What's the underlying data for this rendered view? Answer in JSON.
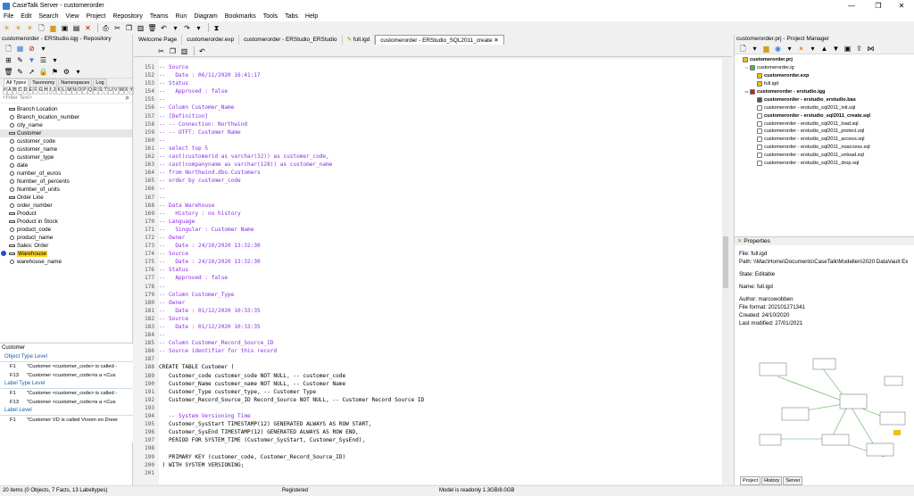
{
  "window": {
    "title": "CaseTalk Server - customerorder",
    "minimize": "—",
    "maximize": "❐",
    "close": "✕"
  },
  "menu": [
    "File",
    "Edit",
    "Search",
    "View",
    "Project",
    "Repository",
    "Teams",
    "Run",
    "Diagram",
    "Bookmarks",
    "Tools",
    "Tabs",
    "Help"
  ],
  "left_panel": {
    "header": "customerorder - ERStudio.iqg - Repository",
    "tabs": [
      "All Types",
      "Taxonomy",
      "Namespaces",
      "Log"
    ],
    "alphabet": [
      "#",
      "A",
      "B",
      "C",
      "D",
      "E",
      "F",
      "G",
      "H",
      "I",
      "J",
      "K",
      "L",
      "M",
      "N",
      "O",
      "P",
      "Q",
      "R",
      "S",
      "T",
      "U",
      "V",
      "W",
      "X",
      "Y",
      "Z"
    ],
    "filter_placeholder": "<Filter Text>",
    "tree": [
      {
        "label": "Branch Location",
        "icon": "entity-icon"
      },
      {
        "label": "Branch_location_number",
        "icon": "circle-icon"
      },
      {
        "label": "city_name",
        "icon": "circle-icon"
      },
      {
        "label": "Customer",
        "icon": "entity-icon",
        "selected": true
      },
      {
        "label": "customer_code",
        "icon": "circle-icon"
      },
      {
        "label": "customer_name",
        "icon": "circle-icon"
      },
      {
        "label": "customer_type",
        "icon": "circle-icon"
      },
      {
        "label": "date",
        "icon": "circle-icon"
      },
      {
        "label": "number_of_euros",
        "icon": "circle-icon"
      },
      {
        "label": "Number_of_percents",
        "icon": "circle-icon"
      },
      {
        "label": "Number_of_units",
        "icon": "circle-icon"
      },
      {
        "label": "Order Line",
        "icon": "entity-icon"
      },
      {
        "label": "order_number",
        "icon": "circle-icon"
      },
      {
        "label": "Product",
        "icon": "entity-icon"
      },
      {
        "label": "Product in Stock",
        "icon": "entity-icon"
      },
      {
        "label": "product_code",
        "icon": "circle-icon"
      },
      {
        "label": "product_name",
        "icon": "circle-icon"
      },
      {
        "label": "Sales: Order",
        "icon": "entity-icon"
      },
      {
        "label": "Warehouse",
        "icon": "entity-icon",
        "highlight": true
      },
      {
        "label": "warehouse_name",
        "icon": "circle-icon"
      }
    ],
    "detail": {
      "header": "Customer",
      "object_type_level": "Object Type Level",
      "otl_rows": [
        {
          "key": "F1",
          "text": "\"Customer <customer_code> is called -"
        },
        {
          "key": "F13",
          "text": "\"Customer <customer_code>is a <Cus"
        }
      ],
      "label_type_level": "Label Type Level",
      "ltl_rows": [
        {
          "key": "F1",
          "text": "\"Customer <customer_code> is called -"
        },
        {
          "key": "F13",
          "text": "\"Customer <customer_code>is a <Cus"
        }
      ],
      "label_level": "Label Level",
      "ll_rows": [
        {
          "key": "F1",
          "text": "\"Customer VD is called Vroom en Dreer"
        }
      ]
    }
  },
  "editor_tabs": [
    "Welcome Page",
    "customerorder.exp",
    "customerorder - ERStudio_ERStudio",
    "full.igd",
    "customerorder - ERStudio_SQL2011_create"
  ],
  "active_tab_index": 4,
  "code_lines": [
    {
      "n": "151",
      "t": "-- Source",
      "c": "cm"
    },
    {
      "n": "152",
      "t": "--   Date : 06/11/2020 16:41:17",
      "c": "cm"
    },
    {
      "n": "153",
      "t": "-- Status",
      "c": "cm"
    },
    {
      "n": "154",
      "t": "--   Approved : false",
      "c": "cm"
    },
    {
      "n": "155",
      "t": "--",
      "c": "cm"
    },
    {
      "n": "156",
      "t": "-- Column Customer_Name",
      "c": "cm"
    },
    {
      "n": "157",
      "t": "-- [Definition]",
      "c": "cm"
    },
    {
      "n": "158",
      "t": "-- -- Connection: Northwind",
      "c": "cm"
    },
    {
      "n": "159",
      "t": "-- -- OTFT: Customer Name",
      "c": "cm"
    },
    {
      "n": "160",
      "t": "--",
      "c": "cm"
    },
    {
      "n": "161",
      "t": "-- select top 5",
      "c": "cm"
    },
    {
      "n": "162",
      "t": "-- cast(customerid as varchar(32)) as customer_code,",
      "c": "cm"
    },
    {
      "n": "163",
      "t": "-- cast(companyname as varchar(128)) as customer_name",
      "c": "cm"
    },
    {
      "n": "164",
      "t": "-- from Northwind.dbo.Customers",
      "c": "cm"
    },
    {
      "n": "165",
      "t": "-- order by customer_code",
      "c": "cm"
    },
    {
      "n": "166",
      "t": "--",
      "c": "cm"
    },
    {
      "n": "167",
      "t": "--",
      "c": "cm"
    },
    {
      "n": "168",
      "t": "-- Data Warehouse",
      "c": "cm"
    },
    {
      "n": "169",
      "t": "--   History : no history",
      "c": "cm"
    },
    {
      "n": "170",
      "t": "-- Language",
      "c": "cm"
    },
    {
      "n": "171",
      "t": "--   Singular : Customer Name",
      "c": "cm"
    },
    {
      "n": "172",
      "t": "-- Owner",
      "c": "cm"
    },
    {
      "n": "173",
      "t": "--   Date : 24/10/2020 13:32:30",
      "c": "cm"
    },
    {
      "n": "174",
      "t": "-- Source",
      "c": "cm"
    },
    {
      "n": "175",
      "t": "--   Date : 24/10/2020 13:32:30",
      "c": "cm"
    },
    {
      "n": "176",
      "t": "-- Status",
      "c": "cm"
    },
    {
      "n": "177",
      "t": "--   Approved : false",
      "c": "cm"
    },
    {
      "n": "178",
      "t": "--",
      "c": "cm"
    },
    {
      "n": "179",
      "t": "-- Column Customer_Type",
      "c": "cm"
    },
    {
      "n": "180",
      "t": "-- Owner",
      "c": "cm"
    },
    {
      "n": "181",
      "t": "--   Date : 01/12/2020 10:33:35",
      "c": "cm"
    },
    {
      "n": "182",
      "t": "-- Source",
      "c": "cm"
    },
    {
      "n": "183",
      "t": "--   Date : 01/12/2020 10:33:35",
      "c": "cm"
    },
    {
      "n": "184",
      "t": "--",
      "c": "cm"
    },
    {
      "n": "185",
      "t": "-- Column Customer_Record_Source_ID",
      "c": "cm"
    },
    {
      "n": "186",
      "t": "-- Source identifier for this record",
      "c": "cm"
    },
    {
      "n": "187",
      "t": "",
      "c": ""
    },
    {
      "n": "188",
      "t": "CREATE TABLE Customer (",
      "c": "kw"
    },
    {
      "n": "189",
      "t": "   Customer_code customer_code NOT NULL, -- customer_code",
      "c": "mix"
    },
    {
      "n": "190",
      "t": "   Customer_Name customer_name NOT NULL, -- Customer Name",
      "c": "mix"
    },
    {
      "n": "191",
      "t": "   Customer_Type customer_type, -- Customer Type",
      "c": "mix"
    },
    {
      "n": "192",
      "t": "   Customer_Record_Source_ID Record_Source NOT NULL, -- Customer Record Source ID",
      "c": "mix"
    },
    {
      "n": "193",
      "t": "",
      "c": ""
    },
    {
      "n": "194",
      "t": "   -- System Versioning Time",
      "c": "cm"
    },
    {
      "n": "195",
      "t": "   Customer_SysStart TIMESTAMP(12) GENERATED ALWAYS AS ROW START,",
      "c": "mix"
    },
    {
      "n": "196",
      "t": "   Customer_SysEnd TIMESTAMP(12) GENERATED ALWAYS AS ROW END,",
      "c": "mix"
    },
    {
      "n": "197",
      "t": "   PERIOD FOR SYSTEM_TIME (Customer_SysStart, Customer_SysEnd),",
      "c": "mix"
    },
    {
      "n": "198",
      "t": "",
      "c": ""
    },
    {
      "n": "199",
      "t": "   PRIMARY KEY (customer_code, Customer_Record_Source_ID)",
      "c": "mix"
    },
    {
      "n": "200",
      "t": " ) WITH SYSTEM VERSIONING;",
      "c": "mix"
    },
    {
      "n": "201",
      "t": "",
      "c": ""
    }
  ],
  "project_manager": {
    "header": "customerorder.prj - Project Manager",
    "items": [
      {
        "label": "customerorder.prj",
        "indent": 0,
        "bold": true,
        "tog": "",
        "color": "#e8c020"
      },
      {
        "label": "customerorder.ig",
        "indent": 1,
        "bold": false,
        "tog": "⌵",
        "color": "#3cc43c"
      },
      {
        "label": "customerorder.exp",
        "indent": 2,
        "bold": true,
        "tog": "",
        "color": "#e8c020"
      },
      {
        "label": "full.igd",
        "indent": 2,
        "bold": false,
        "tog": "",
        "color": "#e8c020"
      },
      {
        "label": "customerorder - erstudio.igg",
        "indent": 1,
        "bold": true,
        "tog": "⌵",
        "color": "#d02020"
      },
      {
        "label": "customerorder - erstudio_erstudio.bas",
        "indent": 2,
        "bold": true,
        "tog": "",
        "color": "#555555"
      },
      {
        "label": "customerorder - erstudio_sql2011_init.sql",
        "indent": 2,
        "bold": false,
        "tog": "",
        "color": "#ffffff"
      },
      {
        "label": "customerorder - erstudio_sql2011_create.sql",
        "indent": 2,
        "bold": true,
        "tog": "",
        "color": "#ffffff"
      },
      {
        "label": "customerorder - erstudio_sql2011_load.sql",
        "indent": 2,
        "bold": false,
        "tog": "",
        "color": "#ffffff"
      },
      {
        "label": "customerorder - erstudio_sql2011_protect.sql",
        "indent": 2,
        "bold": false,
        "tog": "",
        "color": "#ffffff"
      },
      {
        "label": "customerorder - erstudio_sql2011_access.sql",
        "indent": 2,
        "bold": false,
        "tog": "",
        "color": "#ffffff"
      },
      {
        "label": "customerorder - erstudio_sql2011_noaccess.sql",
        "indent": 2,
        "bold": false,
        "tog": "",
        "color": "#ffffff"
      },
      {
        "label": "customerorder - erstudio_sql2011_unload.sql",
        "indent": 2,
        "bold": false,
        "tog": "",
        "color": "#ffffff"
      },
      {
        "label": "customerorder - erstudio_sql2011_drop.sql",
        "indent": 2,
        "bold": false,
        "tog": "",
        "color": "#ffffff"
      }
    ]
  },
  "properties": {
    "header": "Properties",
    "file": "File: full.igd",
    "path": "Path: \\\\Mac\\Home\\Documents\\CaseTalk\\Modellen\\2020 DataVault Ex",
    "state": "State: Editable",
    "name": "Name: full.igd",
    "author": "Author: marcowobben",
    "format": "File format: 202101271341",
    "created": "Created: 24/10/2020",
    "modified": "Last modified: 27/01/2021"
  },
  "right_tabs": [
    "Project",
    "History",
    "Server"
  ],
  "statusbar": {
    "items": "20 items (0 Objects, 7 Facts, 13 Labeltypes)",
    "registered": "Registered",
    "readonly": "Model is readonly  1.3GB/8.0GB"
  },
  "colors": {
    "comment": "#8a2be2",
    "keyword": "#c00030",
    "highlight": "#ffd21f",
    "selection_dot": "#1f4fcf"
  }
}
